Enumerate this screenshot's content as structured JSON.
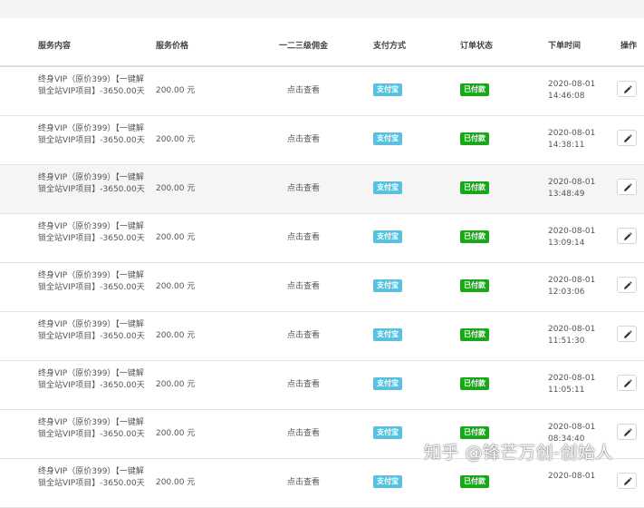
{
  "colors": {
    "pay_badge": "#5bc0de",
    "status_badge": "#1aa61a",
    "header_text": "#444444"
  },
  "table": {
    "headers": {
      "service": "服务内容",
      "price": "服务价格",
      "commission": "一二三级佣金",
      "payment": "支付方式",
      "status": "订单状态",
      "time": "下单时间",
      "action": "操作"
    },
    "rows": [
      {
        "service": "终身VIP（原价399）【一键解锁全站VIP项目】-3650.00天",
        "price": "200.00 元",
        "commission": "点击查看",
        "payment": "支付宝",
        "status": "已付款",
        "date": "2020-08-01",
        "clock": "14:46:08",
        "action_icon": "pencil-icon"
      },
      {
        "service": "终身VIP（原价399）【一键解锁全站VIP项目】-3650.00天",
        "price": "200.00 元",
        "commission": "点击查看",
        "payment": "支付宝",
        "status": "已付款",
        "date": "2020-08-01",
        "clock": "14:38:11",
        "action_icon": "pencil-icon"
      },
      {
        "service": "终身VIP（原价399）【一键解锁全站VIP项目】-3650.00天",
        "price": "200.00 元",
        "commission": "点击查看",
        "payment": "支付宝",
        "status": "已付款",
        "date": "2020-08-01",
        "clock": "13:48:49",
        "action_icon": "pencil-icon"
      },
      {
        "service": "终身VIP（原价399）【一键解锁全站VIP项目】-3650.00天",
        "price": "200.00 元",
        "commission": "点击查看",
        "payment": "支付宝",
        "status": "已付款",
        "date": "2020-08-01",
        "clock": "13:09:14",
        "action_icon": "pencil-icon"
      },
      {
        "service": "终身VIP（原价399）【一键解锁全站VIP项目】-3650.00天",
        "price": "200.00 元",
        "commission": "点击查看",
        "payment": "支付宝",
        "status": "已付款",
        "date": "2020-08-01",
        "clock": "12:03:06",
        "action_icon": "pencil-icon"
      },
      {
        "service": "终身VIP（原价399）【一键解锁全站VIP项目】-3650.00天",
        "price": "200.00 元",
        "commission": "点击查看",
        "payment": "支付宝",
        "status": "已付款",
        "date": "2020-08-01",
        "clock": "11:51:30",
        "action_icon": "pencil-icon"
      },
      {
        "service": "终身VIP（原价399）【一键解锁全站VIP项目】-3650.00天",
        "price": "200.00 元",
        "commission": "点击查看",
        "payment": "支付宝",
        "status": "已付款",
        "date": "2020-08-01",
        "clock": "11:05:11",
        "action_icon": "pencil-icon"
      },
      {
        "service": "终身VIP（原价399）【一键解锁全站VIP项目】-3650.00天",
        "price": "200.00 元",
        "commission": "点击查看",
        "payment": "支付宝",
        "status": "已付款",
        "date": "2020-08-01",
        "clock": "08:34:40",
        "action_icon": "pencil-icon"
      },
      {
        "service": "终身VIP（原价399）【一键解锁全站VIP项目】-3650.00天",
        "price": "200.00 元",
        "commission": "点击查看",
        "payment": "支付宝",
        "status": "已付款",
        "date": "2020-08-01",
        "clock": "",
        "action_icon": "pencil-icon"
      }
    ]
  },
  "watermark": "知乎 @锋芒万创-创始人"
}
